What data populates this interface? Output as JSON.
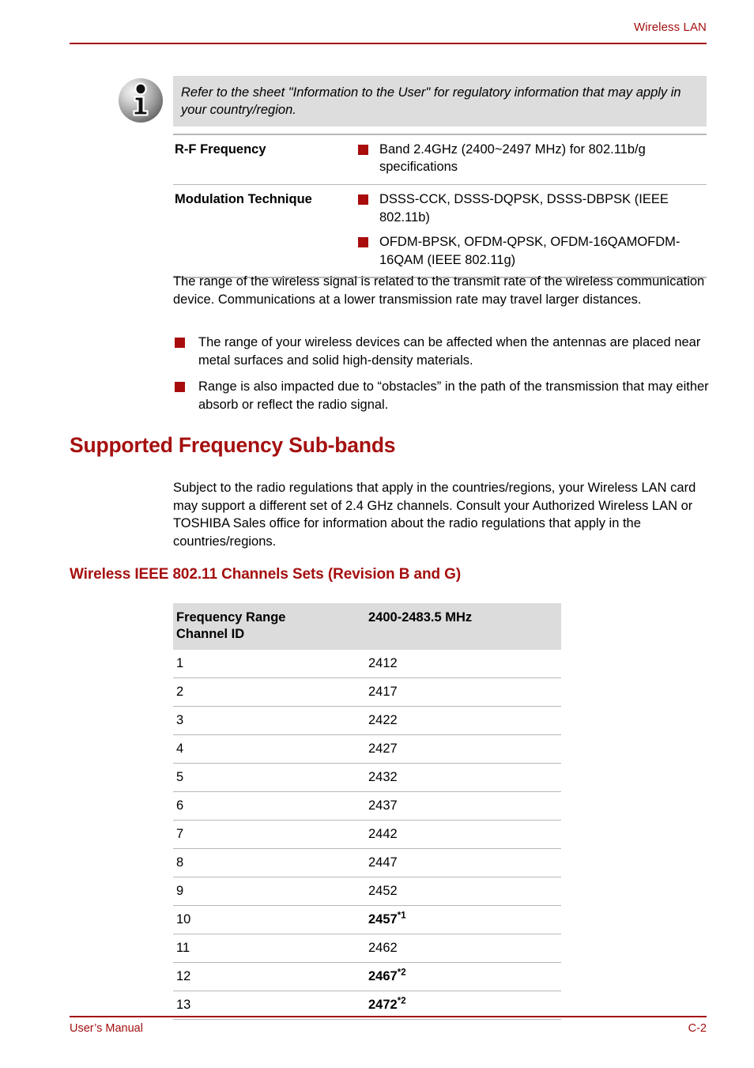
{
  "header": {
    "title": "Wireless LAN"
  },
  "note": {
    "icon": "info-icon",
    "text": "Refer to the sheet \"Information to the User\" for regulatory information that may apply in your country/region."
  },
  "spec_table": {
    "rows": [
      {
        "label": "R-F Frequency",
        "items": [
          "Band 2.4GHz (2400~2497 MHz) for 802.11b/g specifications"
        ]
      },
      {
        "label": "Modulation Technique",
        "items": [
          "DSSS-CCK, DSSS-DQPSK, DSSS-DBPSK (IEEE 802.11b)",
          "OFDM-BPSK, OFDM-QPSK, OFDM-16QAMOFDM-16QAM (IEEE 802.11g)"
        ]
      }
    ]
  },
  "range_paragraph": "The range of the wireless signal is related to the transmit rate of the wireless communication device. Communications at a lower transmission rate may travel larger distances.",
  "range_bullets": [
    "The range of your wireless devices can be affected when the antennas are placed near metal surfaces and solid high-density materials.",
    "Range is also impacted due to “obstacles” in the path of the transmission that may either absorb or reflect the radio signal."
  ],
  "section": {
    "heading": "Supported Frequency Sub-bands",
    "paragraph": "Subject to the radio regulations that apply in the countries/regions, your Wireless LAN card may support a different set of 2.4 GHz channels. Consult your Authorized Wireless LAN or TOSHIBA Sales office for information about the radio regulations that apply in the countries/regions.",
    "subheading": "Wireless IEEE 802.11 Channels Sets (Revision B and G)"
  },
  "channel_table": {
    "header": {
      "col1_line1": "Frequency Range",
      "col1_line2": "Channel ID",
      "col2": "2400-2483.5 MHz"
    },
    "rows": [
      {
        "channel": "1",
        "frequency": "2412",
        "footnote": "",
        "bold": false
      },
      {
        "channel": "2",
        "frequency": "2417",
        "footnote": "",
        "bold": false
      },
      {
        "channel": "3",
        "frequency": "2422",
        "footnote": "",
        "bold": false
      },
      {
        "channel": "4",
        "frequency": "2427",
        "footnote": "",
        "bold": false
      },
      {
        "channel": "5",
        "frequency": "2432",
        "footnote": "",
        "bold": false
      },
      {
        "channel": "6",
        "frequency": "2437",
        "footnote": "",
        "bold": false
      },
      {
        "channel": "7",
        "frequency": "2442",
        "footnote": "",
        "bold": false
      },
      {
        "channel": "8",
        "frequency": "2447",
        "footnote": "",
        "bold": false
      },
      {
        "channel": "9",
        "frequency": "2452",
        "footnote": "",
        "bold": false
      },
      {
        "channel": "10",
        "frequency": "2457",
        "footnote": "*1",
        "bold": true
      },
      {
        "channel": "11",
        "frequency": "2462",
        "footnote": "",
        "bold": false
      },
      {
        "channel": "12",
        "frequency": "2467",
        "footnote": "*2",
        "bold": true
      },
      {
        "channel": "13",
        "frequency": "2472",
        "footnote": "*2",
        "bold": true
      }
    ]
  },
  "footer": {
    "left": "User’s Manual",
    "right": "C-2"
  },
  "colors": {
    "accent_red": "#A50F0F",
    "bullet_red": "#A80C0C",
    "note_bg": "#DDDDDD",
    "table_head_bg": "#DCDCDC",
    "rule_grey": "#B7B7B7"
  }
}
